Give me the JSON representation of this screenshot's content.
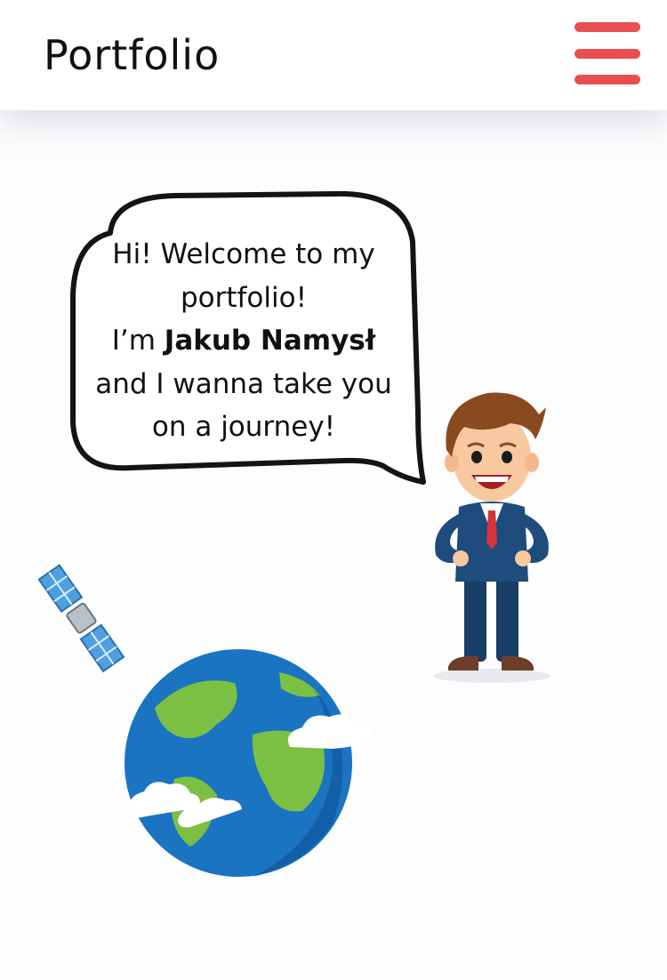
{
  "header": {
    "title": "Portfolio",
    "menu_icon": "hamburger-menu-icon"
  },
  "hero": {
    "line1": "Hi! Welcome to my",
    "line2": "portfolio!",
    "line3_prefix": "I’m ",
    "name": "Jakub Namysł",
    "line4": "and I wanna take you",
    "line5": "on a journey!"
  },
  "illustrations": {
    "character": "cartoon-businessman-illustration",
    "satellite": "satellite-icon",
    "earth": "earth-globe-illustration"
  },
  "colors": {
    "accent": "#e8504f",
    "text": "#111111",
    "background": "#fdfdfe"
  }
}
